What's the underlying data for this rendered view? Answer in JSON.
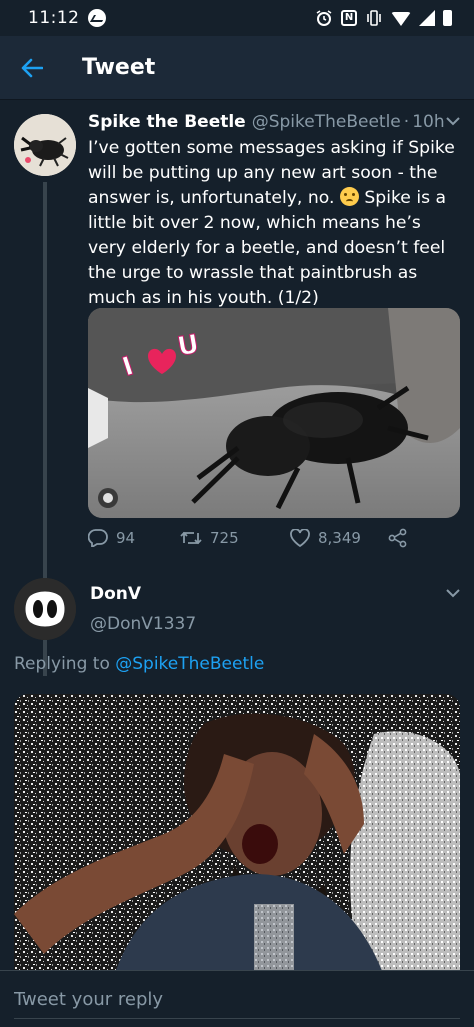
{
  "status_bar": {
    "time": "11:12",
    "icons": [
      "messenger-icon",
      "alarm-icon",
      "nfc-icon",
      "vibrate-icon",
      "wifi-icon",
      "signal-icon",
      "battery-icon"
    ]
  },
  "header": {
    "back_icon": "arrow-left-icon",
    "title": "Tweet"
  },
  "tweet": {
    "name": "Spike the Beetle",
    "handle": "@SpikeTheBeetle",
    "separator": "·",
    "time": "10h",
    "text_before_emoji": "I’ve gotten some messages asking if Spike will be putting up any new art soon - the answer is, unfortunately, no.",
    "emoji": "crying-face-emoji",
    "text_after_emoji": "Spike is a little bit over 2 now, which means he’s very elderly for a beetle, and doesn’t feel the urge to wrassle that paintbrush as much as in his youth. (1/2)",
    "media": {
      "description": "gif of a stag beetle on a grey sweater",
      "sticker_text": "I U"
    },
    "replies": "94",
    "retweets": "725",
    "likes": "8,349"
  },
  "reply": {
    "name": "DonV",
    "handle": "@DonV1337",
    "replying_prefix": "Replying to",
    "replying_to": "@SpikeTheBeetle",
    "media": {
      "description": "deep-fried image of a man crying with hands on head"
    }
  },
  "composer": {
    "placeholder": "Tweet your reply"
  },
  "colors": {
    "background": "#15202b",
    "app_bar": "#1c2938",
    "accent": "#1da1f2",
    "muted": "#8899a6"
  }
}
